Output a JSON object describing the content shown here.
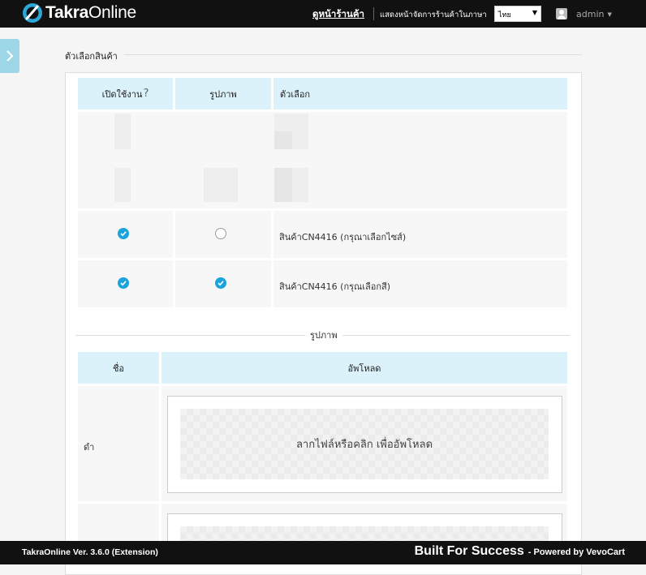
{
  "header": {
    "brand_bold": "Takra",
    "brand_rest": "Online",
    "view_store_link": "ดูหน้าร้านค้า",
    "language_label": "แสดงหน้าจัดการร้านค้าในภาษา",
    "language_value": "ไทย",
    "user": "admin"
  },
  "section": {
    "title": "ตัวเลือกสินค้า"
  },
  "options_table": {
    "columns": [
      "เปิดใช้งาน",
      "รูปภาพ",
      "ตัวเลือก"
    ],
    "enable_question_mark": "?",
    "rows": [
      {
        "enabled": true,
        "image": false,
        "label": "สินค้าCN4416 (กรุณาเลือกไซส์)"
      },
      {
        "enabled": true,
        "image": true,
        "label": "สินค้าCN4416 (กรุณเลือกสี)"
      }
    ]
  },
  "images_section": {
    "title": "รูปภาพ",
    "columns": [
      "ชื่อ",
      "อัพโหลด"
    ],
    "rows": [
      {
        "name": "ดำ",
        "dropzone_text": "ลากไฟล์หรือคลิก เพื่ออัพโหลด"
      },
      {
        "name": "",
        "dropzone_text": ""
      }
    ]
  },
  "footer": {
    "version": "TakraOnline Ver. 3.6.0 (Extension)",
    "slogan": "Built For Success",
    "powered": "- Powered by VevoCart"
  },
  "colors": {
    "header_bg": "#111111",
    "table_header_bg": "#dcf2fb",
    "accent": "#1aa3dc",
    "side_toggle": "#9dd6e6"
  }
}
